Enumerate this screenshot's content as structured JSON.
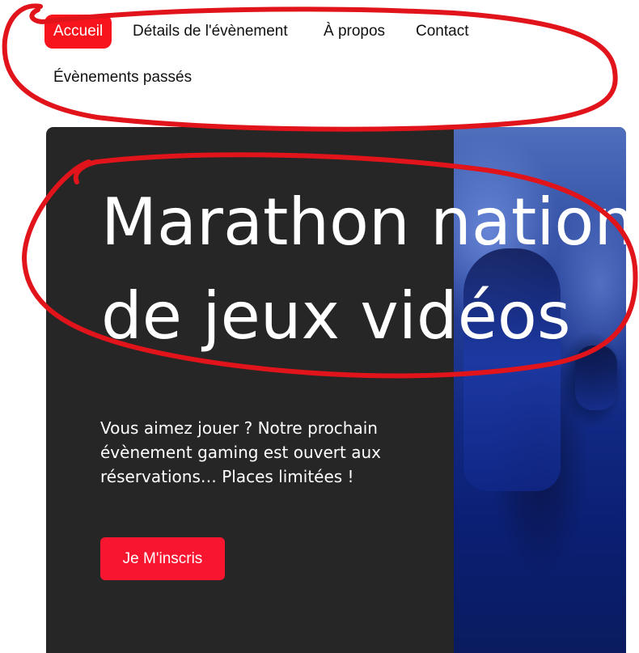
{
  "nav": {
    "items": [
      {
        "label": "Accueil",
        "active": true
      },
      {
        "label": "Détails de l'évènement",
        "active": false
      },
      {
        "label": "À propos",
        "active": false
      },
      {
        "label": "Contact",
        "active": false
      },
      {
        "label": "Évènements passés",
        "active": false
      }
    ]
  },
  "hero": {
    "title_line1": "Marathon national",
    "title_line2": "de jeux vidéos",
    "description": "Vous aimez jouer ? Notre prochain évènement gaming est ouvert aux réservations… Places limitées !",
    "cta_label": "Je M'inscris"
  },
  "colors": {
    "accent": "#f7141c",
    "hero_background": "#262626",
    "annotation": "#e0141a"
  }
}
